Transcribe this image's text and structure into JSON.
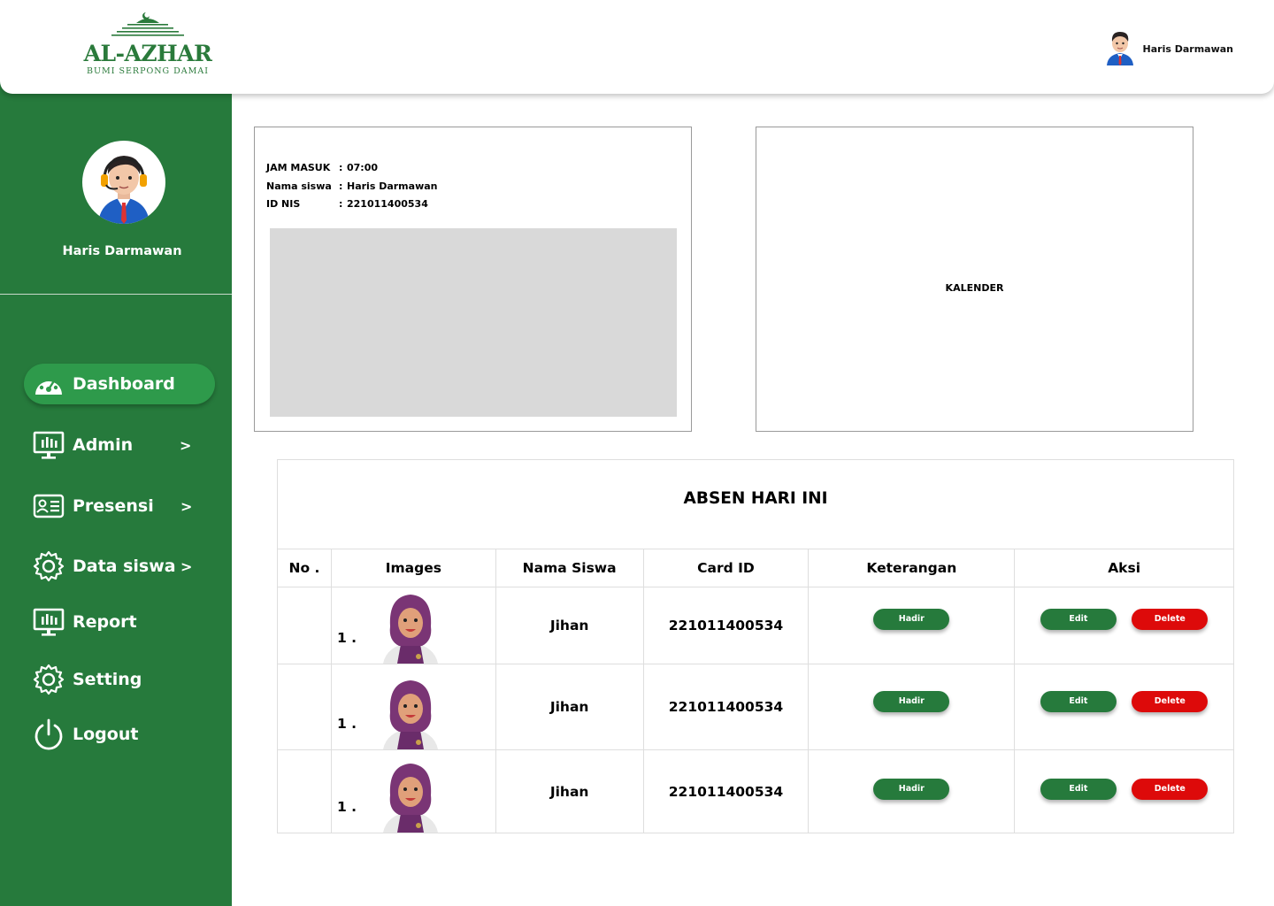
{
  "header": {
    "logo_text": "AL-AZHAR",
    "logo_sub": "BUMI SERPONG DAMAI",
    "user_name": "Haris Darmawan"
  },
  "sidebar": {
    "user_name": "Haris Darmawan",
    "items": [
      {
        "label": "Dashboard",
        "icon": "dashboard-icon",
        "active": true
      },
      {
        "label": "Admin",
        "icon": "monitor-chart-icon",
        "chevron": true
      },
      {
        "label": "Presensi",
        "icon": "id-card-icon",
        "chevron": true
      },
      {
        "label": "Data siswa",
        "icon": "gear-icon",
        "chevron": true
      },
      {
        "label": "Report",
        "icon": "monitor-chart-icon"
      },
      {
        "label": "Setting",
        "icon": "gear-icon"
      },
      {
        "label": "Logout",
        "icon": "power-icon"
      }
    ],
    "chevron": ">"
  },
  "info": {
    "rows": [
      {
        "key": "JAM MASUK",
        "sep": ":",
        "value": "07:00"
      },
      {
        "key": "Nama siswa",
        "sep": ":",
        "value": "Haris Darmawan"
      },
      {
        "key": "ID NIS",
        "sep": ":",
        "value": "221011400534"
      }
    ]
  },
  "calendar": {
    "label": "KALENDER"
  },
  "table": {
    "title": "ABSEN HARI INI",
    "headers": [
      "No .",
      "Images",
      "Nama Siswa",
      "Card ID",
      "Keterangan",
      "Aksi"
    ],
    "rows": [
      {
        "no": "1 .",
        "name": "Jihan",
        "card_id": "221011400534",
        "status": "Hadir",
        "edit": "Edit",
        "delete": "Delete"
      },
      {
        "no": "1 .",
        "name": "Jihan",
        "card_id": "221011400534",
        "status": "Hadir",
        "edit": "Edit",
        "delete": "Delete"
      },
      {
        "no": "1 .",
        "name": "Jihan",
        "card_id": "221011400534",
        "status": "Hadir",
        "edit": "Edit",
        "delete": "Delete"
      }
    ]
  },
  "colors": {
    "brand_green": "#267a3c",
    "active_green": "#2e9a4b",
    "delete_red": "#dd0a0a"
  }
}
